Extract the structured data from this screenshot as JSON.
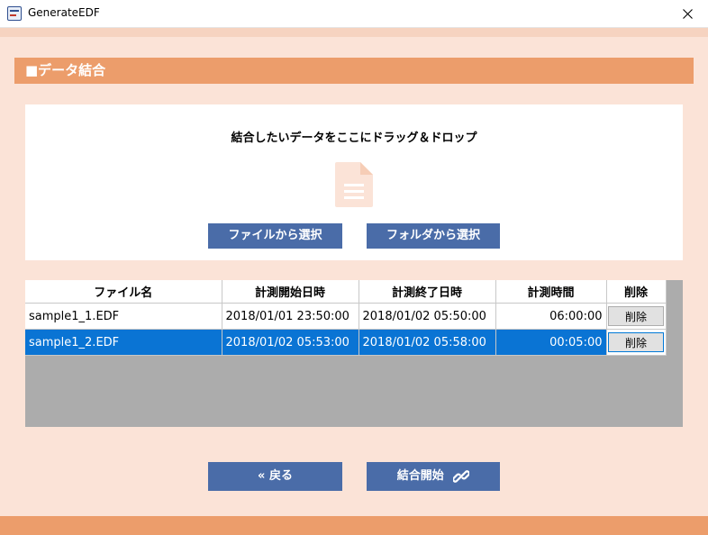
{
  "window": {
    "title": "GenerateEDF"
  },
  "section": {
    "title": "■データ結合"
  },
  "drop_zone": {
    "instruction": "結合したいデータをここにドラッグ＆ドロップ",
    "icon": "document-icon",
    "select_file_label": "ファイルから選択",
    "select_folder_label": "フォルダから選択"
  },
  "table": {
    "headers": [
      "ファイル名",
      "計測開始日時",
      "計測終了日時",
      "計測時間",
      "削除"
    ],
    "rows": [
      {
        "file": "sample1_1.EDF",
        "start": "2018/01/01 23:50:00",
        "end": "2018/01/02 05:50:00",
        "duration": "06:00:00",
        "delete": "削除",
        "selected": false
      },
      {
        "file": "sample1_2.EDF",
        "start": "2018/01/02 05:53:00",
        "end": "2018/01/02 05:58:00",
        "duration": "00:05:00",
        "delete": "削除",
        "selected": true
      }
    ]
  },
  "footer": {
    "back_label": "« 戻る",
    "merge_label": "結合開始",
    "merge_icon": "link-icon"
  },
  "colors": {
    "accent": "#ec9d6b",
    "background": "#fbe3d7",
    "button": "#4a6ca8",
    "selection": "#0a74d4"
  }
}
